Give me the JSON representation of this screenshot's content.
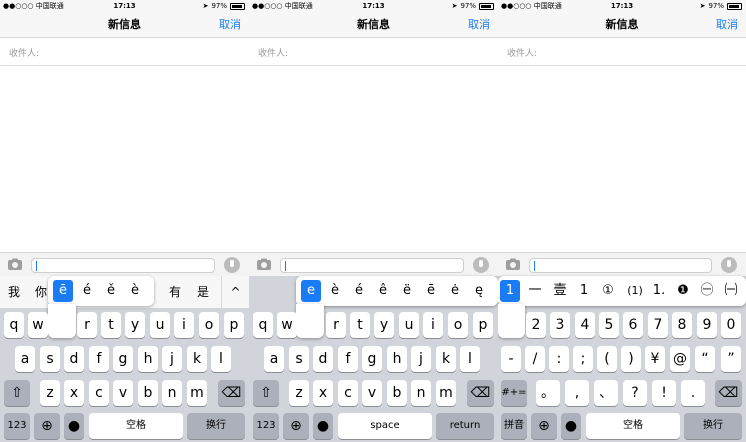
{
  "status": {
    "carrier": "●●○○○ 中国联通",
    "time": "17:13",
    "battery": "97%"
  },
  "header": {
    "title": "新信息",
    "cancel": "取消"
  },
  "recipient": {
    "label": "收件人:"
  },
  "panel1": {
    "candidates": [
      "我",
      "你",
      "有",
      "是"
    ],
    "popup": [
      "ē",
      "é",
      "ě",
      "è"
    ],
    "row1": [
      "q",
      "w",
      "r",
      "t",
      "y",
      "u",
      "i",
      "o",
      "p"
    ],
    "row2": [
      "a",
      "s",
      "d",
      "f",
      "g",
      "h",
      "j",
      "k",
      "l"
    ],
    "row3": [
      "z",
      "x",
      "c",
      "v",
      "b",
      "n",
      "m"
    ],
    "k123": "123",
    "space": "空格",
    "return": "换行"
  },
  "panel2": {
    "popup": [
      "e",
      "è",
      "é",
      "ê",
      "ë",
      "ē",
      "ė",
      "ę"
    ],
    "row1": [
      "q",
      "w",
      "r",
      "t",
      "y",
      "u",
      "i",
      "o",
      "p"
    ],
    "row2": [
      "a",
      "s",
      "d",
      "f",
      "g",
      "h",
      "j",
      "k",
      "l"
    ],
    "row3": [
      "z",
      "x",
      "c",
      "v",
      "b",
      "n",
      "m"
    ],
    "k123": "123",
    "space": "space",
    "return": "return"
  },
  "panel3": {
    "popup": [
      "1",
      "一",
      "壹",
      "1",
      "①",
      "(1)",
      "1.",
      "❶",
      "㊀",
      "㈠"
    ],
    "row1": [
      "2",
      "3",
      "4",
      "5",
      "6",
      "7",
      "8",
      "9",
      "0"
    ],
    "row2": [
      "-",
      "/",
      ":",
      ";",
      "(",
      ")",
      "¥",
      "@",
      "“",
      "”"
    ],
    "row3": [
      "。",
      ",",
      "、",
      "?",
      "!",
      "."
    ],
    "sym": "#+=",
    "pinyin": "拼音",
    "space": "空格",
    "return": "换行"
  }
}
